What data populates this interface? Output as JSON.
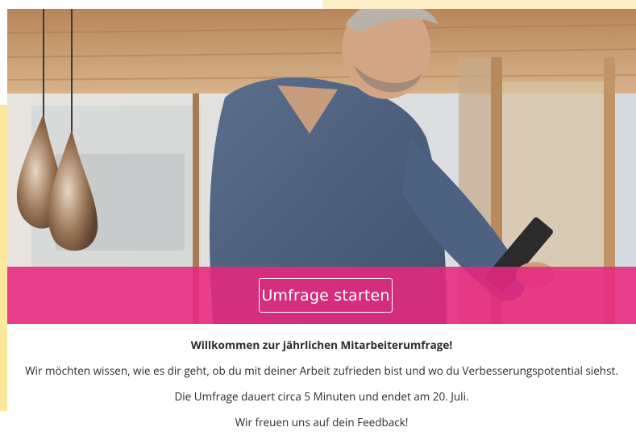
{
  "hero": {
    "image": "man-with-tablet-photo",
    "cta_label": "Umfrage starten"
  },
  "welcome": {
    "headline": "Willkommen zur jährlichen Mitarbeiterumfrage!",
    "intro": "Wir möchten wissen, wie es dir geht, ob du mit deiner Arbeit zufrieden bist und wo du Verbesserungspotential siehst.",
    "duration": "Die Umfrage dauert circa 5 Minuten und endet am 20. Juli.",
    "closing": "Wir freuen uns auf dein Feedback!"
  },
  "colors": {
    "accent": "#e7287e",
    "decor_yellow": "#fbe89a"
  }
}
